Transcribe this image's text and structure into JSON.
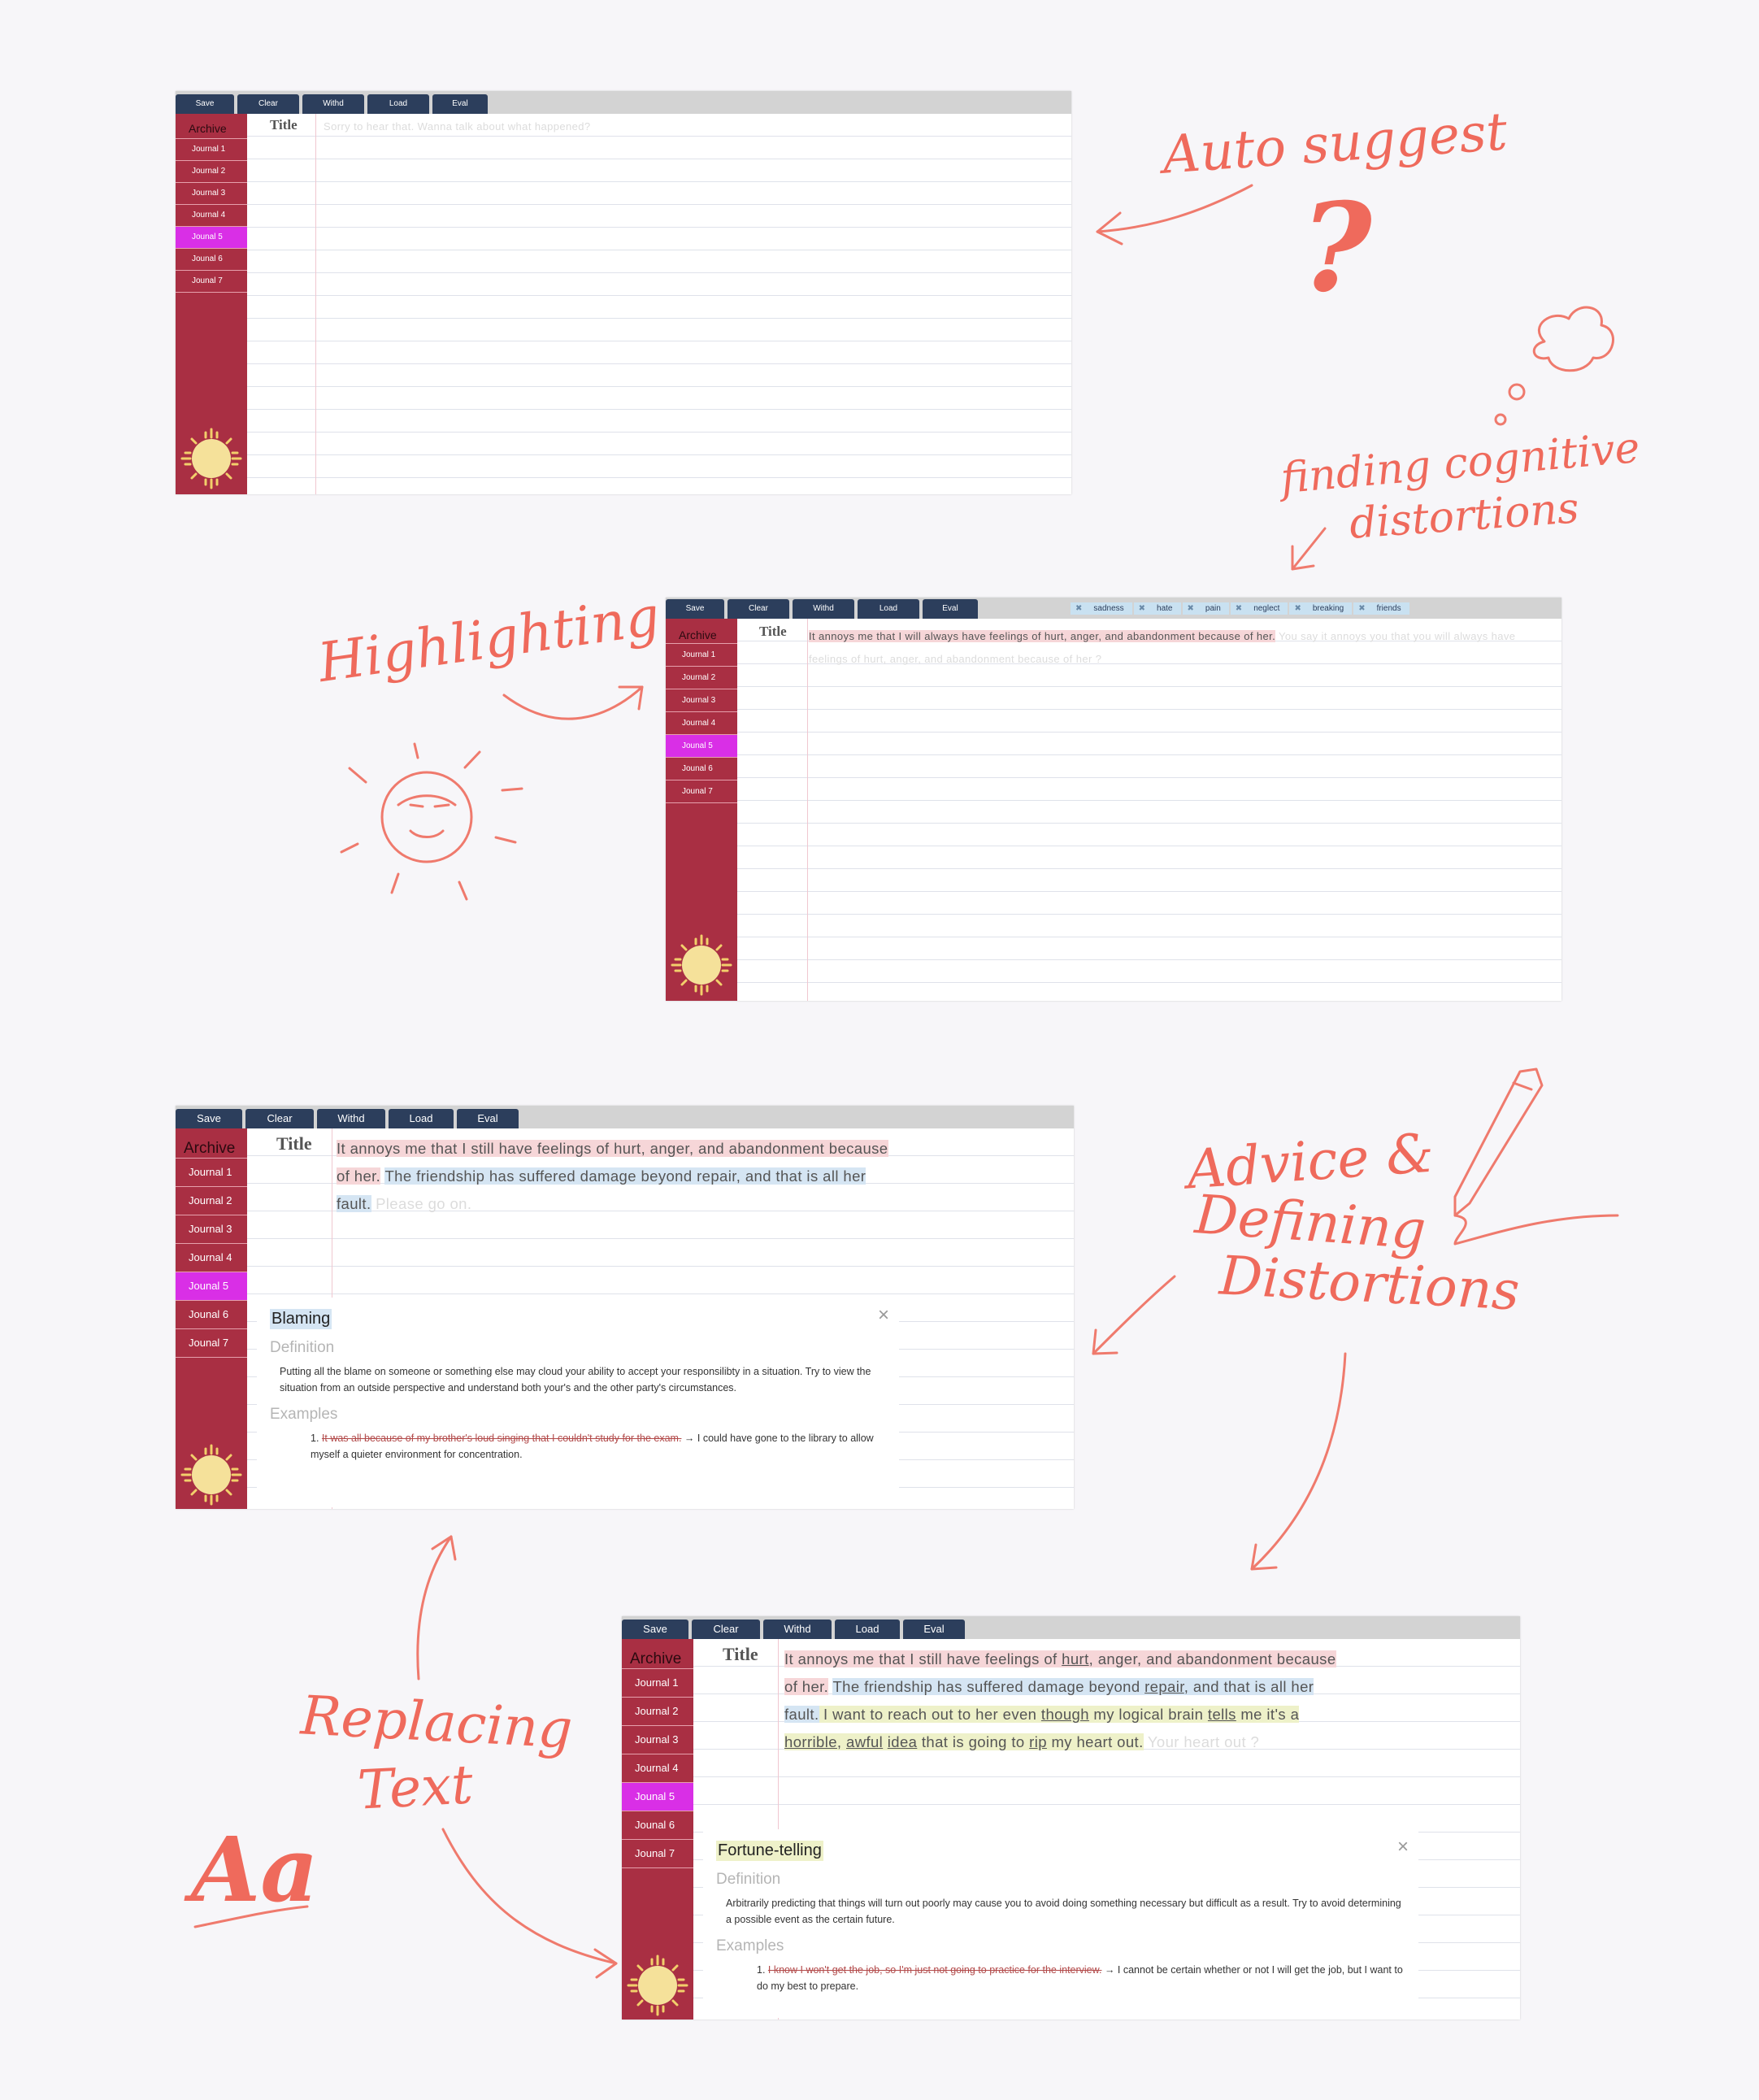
{
  "toolbar": {
    "save": "Save",
    "clear": "Clear",
    "withd": "Withd",
    "load": "Load",
    "eval": "Eval"
  },
  "sidebar": {
    "archive": "Archive",
    "journals": [
      "Journal 1",
      "Journal 2",
      "Journal 3",
      "Journal 4",
      "Jounal 5",
      "Jounal 6",
      "Jounal 7"
    ]
  },
  "title_label": "Title",
  "panel1": {
    "placeholder": "Sorry to hear that. Wanna talk about what happened?"
  },
  "panel2": {
    "tags": [
      "sadness",
      "hate",
      "pain",
      "neglect",
      "breaking",
      "friends"
    ],
    "text": "It annoys me that I will always have feelings of hurt, anger, and abandonment because of her.",
    "suggest1": "You say it",
    "suggest2": "annoys you that you will always have feelings of hurt, anger, and abandonment because of her ?"
  },
  "panel3": {
    "line1": "It annoys me that I still have feelings of hurt, anger, and abandonment because",
    "line2a": "of her.",
    "line2b": "The friendship has suffered damage beyond repair, and that is all her",
    "line3a": "fault.",
    "line3b": "Please go on.",
    "card": {
      "name": "Blaming",
      "definition_label": "Definition",
      "definition": "Putting all the blame on someone or something else may cloud your ability to accept your responsilibty in a situation. Try to view the situation from an outside perspective and understand both your's and the other party's circumstances.",
      "examples_label": "Examples",
      "example_wrong": "It was all because of my brother's loud singing that I couldn't study for the exam.",
      "example_right": "→ I could have gone to the library to allow myself a quieter environment for concentration.",
      "close": "×"
    }
  },
  "panel4": {
    "l1a": "It annoys me that I still have feelings of ",
    "l1b": "hurt",
    "l1c": ", anger, and abandonment because",
    "l2a": "of her.",
    "l2b": "The friendship has suffered damage beyond ",
    "l2c": "repair",
    "l2d": ", and that is all her",
    "l3a": "fault.",
    "l3b": " I want to reach out to her even ",
    "l3c": "though",
    "l3d": " my logical brain ",
    "l3e": "tells",
    "l3f": " me it's a",
    "l4a": "horrible",
    "l4b": ", ",
    "l4c": "awful",
    "l4d": " ",
    "l4e": "idea",
    "l4f": " that is going to ",
    "l4g": "rip",
    "l4h": " my heart out.",
    "l4i": "Your heart out ?",
    "card": {
      "name": "Fortune-telling",
      "definition_label": "Definition",
      "definition": "Arbitrarily predicting that things will turn out poorly may cause you to avoid doing something necessary but difficult as a result. Try to avoid determining a possible event as the certain future.",
      "examples_label": "Examples",
      "example_wrong": "I know I won't get the job, so I'm just not going to practice for the interview.",
      "example_right": "→ I cannot be certain whether or not I will get the job, but I want to do my best to prepare.",
      "close": "×"
    }
  },
  "annotations": {
    "auto_suggest": "Auto suggest",
    "question": "?",
    "finding1": "finding cognitive",
    "finding2": "distortions",
    "highlighting": "Highlighting",
    "advice1": "Advice &",
    "advice2": "Defining",
    "advice3": "Distortions",
    "replacing1": "Replacing",
    "replacing2": "Text",
    "aa": "Aa"
  },
  "colors": {
    "toolbar_button": "#2c3e5c",
    "sidebar": "#a92f43",
    "active_journal": "#d92fe6",
    "annotation": "#ef6a5c",
    "highlight_red": "#f6d6d8",
    "highlight_blue": "#d5e5f3",
    "highlight_green": "#eef1c9"
  }
}
